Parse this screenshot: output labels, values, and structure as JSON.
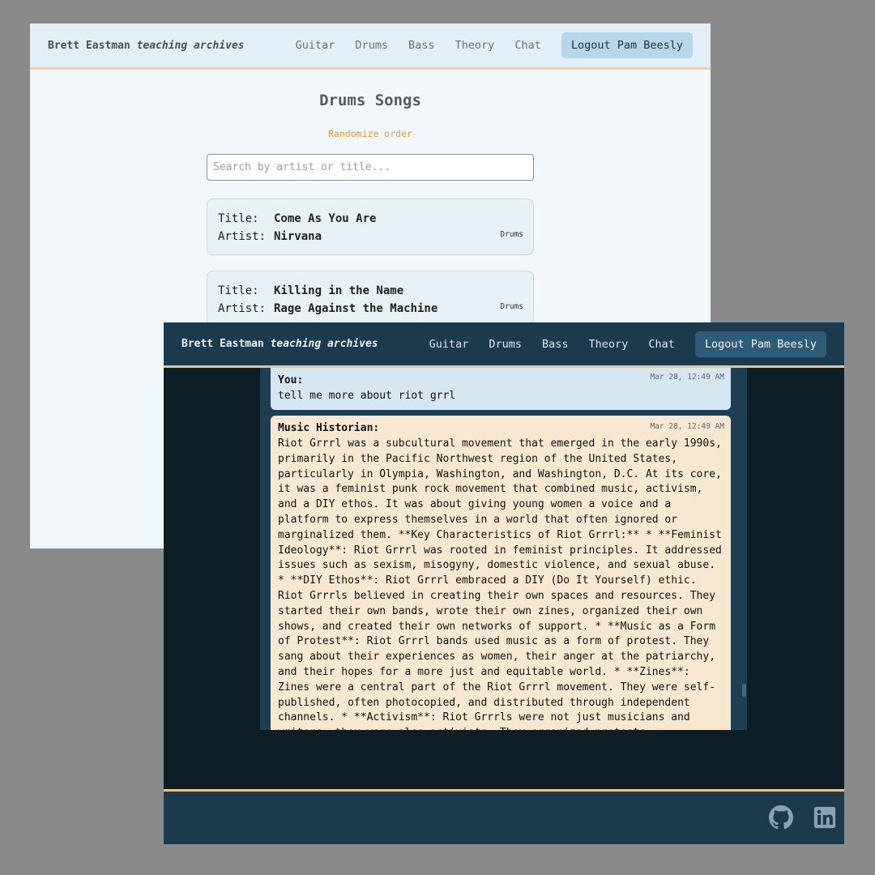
{
  "songs_window": {
    "brand": {
      "name": "Brett Eastman",
      "suffix": "teaching archives"
    },
    "nav": [
      "Guitar",
      "Drums",
      "Bass",
      "Theory",
      "Chat"
    ],
    "logout_label": "Logout Pam Beesly",
    "page_title": "Drums Songs",
    "randomize_label": "Randomize order",
    "search_placeholder": "Search by artist or title...",
    "title_label": "Title:",
    "artist_label": "Artist:",
    "songs": [
      {
        "title": "Come As You Are",
        "artist": "Nirvana",
        "tag": "Drums"
      },
      {
        "title": "Killing in the Name",
        "artist": "Rage Against the Machine",
        "tag": "Drums"
      }
    ]
  },
  "chat_window": {
    "brand": {
      "name": "Brett Eastman",
      "suffix": "teaching archives"
    },
    "nav": [
      "Guitar",
      "Drums",
      "Bass",
      "Theory",
      "Chat"
    ],
    "logout_label": "Logout Pam Beesly",
    "messages": [
      {
        "sender": "You:",
        "time": "Mar 28, 12:49 AM",
        "text": "tell me more about riot grrl"
      },
      {
        "sender": "Music Historian:",
        "time": "Mar 28, 12:49 AM",
        "text": "Riot Grrrl was a subcultural movement that emerged in the early 1990s, primarily in the Pacific Northwest region of the United States, particularly in Olympia, Washington, and Washington, D.C. At its core, it was a feminist punk rock movement that combined music, activism, and a DIY ethos. It was about giving young women a voice and a platform to express themselves in a world that often ignored or marginalized them. **Key Characteristics of Riot Grrrl:** * **Feminist Ideology**: Riot Grrrl was rooted in feminist principles. It addressed issues such as sexism, misogyny, domestic violence, and sexual abuse. * **DIY Ethos**: Riot Grrrl embraced a DIY (Do It Yourself) ethic. Riot Grrrls believed in creating their own spaces and resources. They started their own bands, wrote their own zines, organized their own shows, and created their own networks of support. * **Music as a Form of Protest**: Riot Grrrl bands used music as a form of protest. They sang about their experiences as women, their anger at the patriarchy, and their hopes for a more just and equitable world. * **Zines**: Zines were a central part of the Riot Grrrl movement. They were self-published, often photocopied, and distributed through independent channels. * **Activism**: Riot Grrrls were not just musicians and writers; they were also activists. They organized protests,"
      }
    ],
    "footer_icons": [
      "github-icon",
      "linkedin-icon"
    ]
  }
}
